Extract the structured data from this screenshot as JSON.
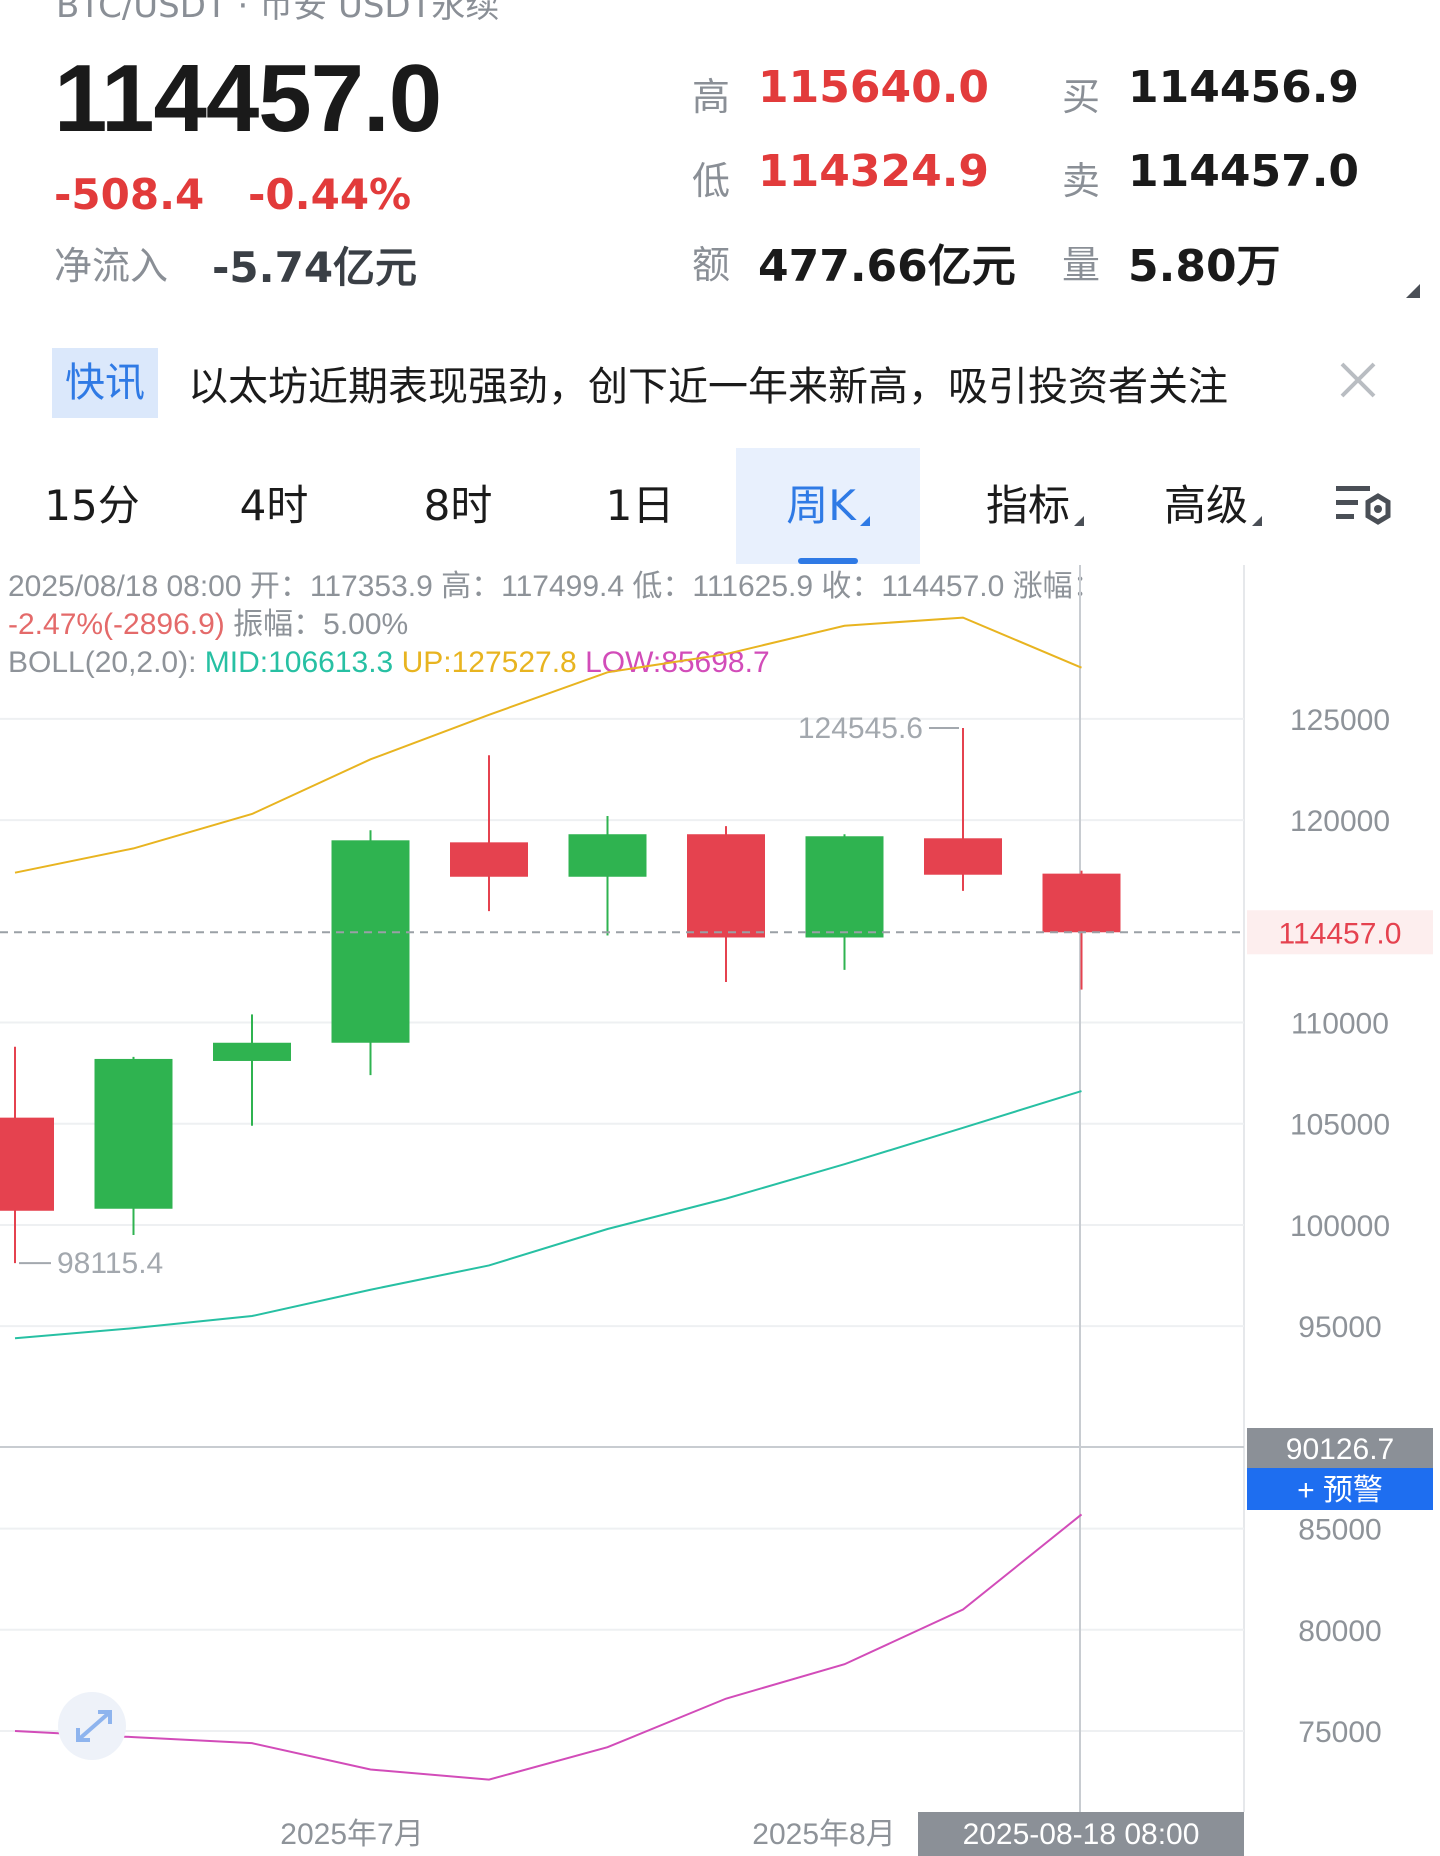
{
  "header": {
    "title_partial": "BTC/USDT · 币安 USDT永续",
    "last_price": "114457.0",
    "change": "-508.4",
    "change_pct": "-0.44%",
    "net_inflow_label": "净流入",
    "net_inflow_value": "-5.74亿元",
    "stats": {
      "high_label": "高",
      "high_value": "115640.0",
      "low_label": "低",
      "low_value": "114324.9",
      "amount_label": "额",
      "amount_value": "477.66亿元",
      "bid_label": "买",
      "bid_value": "114456.9",
      "ask_label": "卖",
      "ask_value": "114457.0",
      "volume_label": "量",
      "volume_value": "5.80万"
    }
  },
  "news": {
    "tag": "快讯",
    "text": "以太坊近期表现强劲，创下近一年来新高，吸引投资者关注"
  },
  "tabs": [
    {
      "label": "15分"
    },
    {
      "label": "4时"
    },
    {
      "label": "8时"
    },
    {
      "label": "1日"
    },
    {
      "label": "周K",
      "active": true
    },
    {
      "label": "指标"
    },
    {
      "label": "高级"
    }
  ],
  "info": {
    "line1": "2025/08/18 08:00 开：117353.9 高：117499.4 低：111625.9 收：114457.0 涨幅：",
    "change": "-2.47%(-2896.9)",
    "amplitude": " 振幅：5.00%",
    "boll_label": "BOLL(20,2.0): ",
    "mid": "MID:106613.3",
    "up": "UP:127527.8",
    "low": "LOW:85698.7"
  },
  "chart_data": {
    "type": "candlestick",
    "indicator": "BOLL(20,2.0)",
    "ylim": [
      71000,
      132600
    ],
    "y_ticks": [
      125000,
      120000,
      110000,
      105000,
      100000,
      95000,
      85000,
      80000,
      75000
    ],
    "x_labels": [
      "2025年7月",
      "2025年8月"
    ],
    "crosshair_time": "2025-08-18 08:00",
    "crosshair_price": "90126.7",
    "current_price_label": "114457.0",
    "current_price": 114457.0,
    "alert_button": "+ 预警",
    "max_label": "124545.6",
    "min_label": "98115.4",
    "candles": [
      {
        "open": 105300,
        "close": 100700,
        "high": 108800,
        "low": 98115.4
      },
      {
        "open": 100800,
        "close": 108200,
        "high": 108300,
        "low": 99500
      },
      {
        "open": 108100,
        "close": 109000,
        "high": 110400,
        "low": 104900
      },
      {
        "open": 109000,
        "close": 119000,
        "high": 119500,
        "low": 107400
      },
      {
        "open": 118900,
        "close": 117200,
        "high": 123200,
        "low": 115500
      },
      {
        "open": 117200,
        "close": 119300,
        "high": 120200,
        "low": 114300
      },
      {
        "open": 119300,
        "close": 114200,
        "high": 119700,
        "low": 112000
      },
      {
        "open": 114200,
        "close": 119200,
        "high": 119300,
        "low": 112600
      },
      {
        "open": 119100,
        "close": 117300,
        "high": 124545.6,
        "low": 116500
      },
      {
        "open": 117353.9,
        "close": 114457.0,
        "high": 117499.4,
        "low": 111625.9
      }
    ],
    "boll_up": [
      117400,
      118600,
      120300,
      123000,
      125200,
      127300,
      128200,
      129600,
      130000,
      127527.8
    ],
    "boll_mid": [
      94400,
      94900,
      95500,
      96800,
      98000,
      99800,
      101300,
      103000,
      104800,
      106613.3
    ],
    "boll_low": [
      75000,
      74700,
      74400,
      73100,
      72600,
      74200,
      76600,
      78300,
      81000,
      85698.7
    ],
    "colors": {
      "up": "#2fb350",
      "down": "#e5424f",
      "boll_up": "#e8b420",
      "boll_mid": "#27c0a3",
      "boll_low": "#d24cb9",
      "alert": "#1e6ef0"
    }
  }
}
